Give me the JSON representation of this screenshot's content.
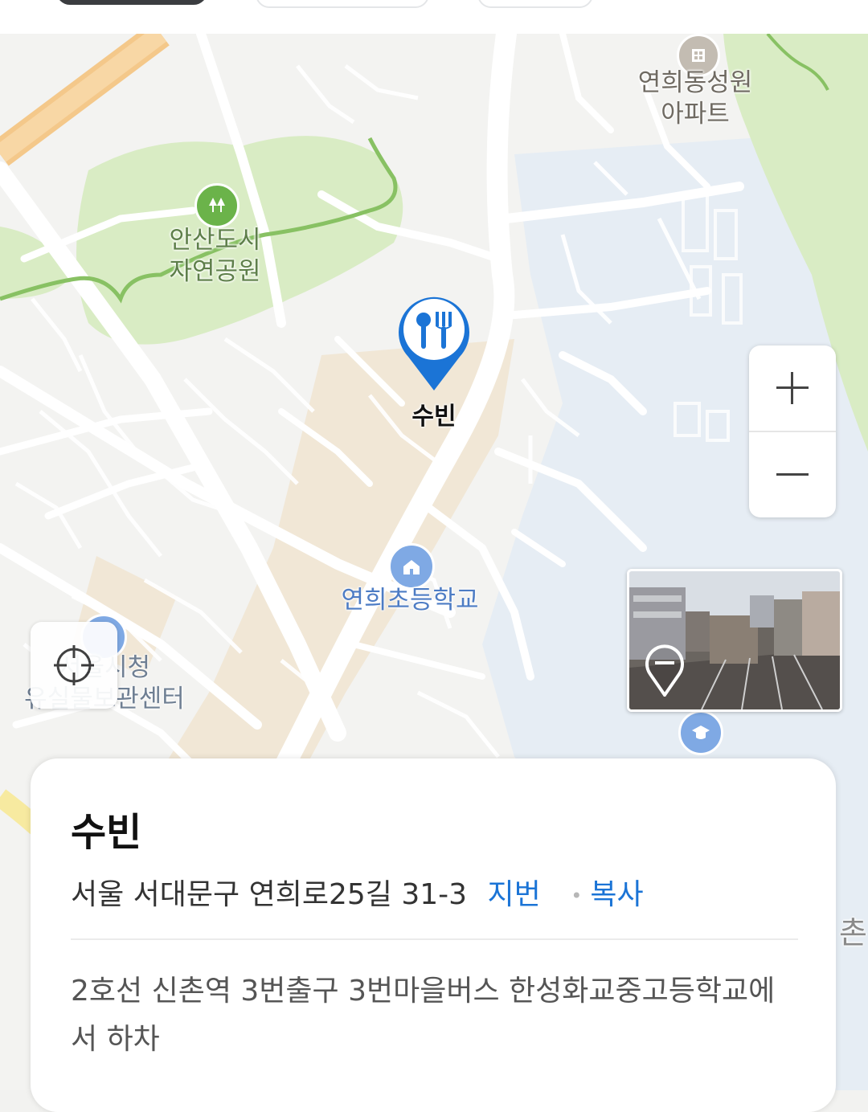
{
  "map": {
    "labels": {
      "apartment": "연희동성원\n아파트",
      "park": "안산도시\n자연공원",
      "school": "연희초등학교",
      "center": "서울시청\n유실물보관센터",
      "edge": "촌"
    },
    "marker": {
      "icon": "restaurant-pin-icon",
      "label": "수빈"
    },
    "zoom_in_label": "+",
    "zoom_out_label": "−",
    "locate_icon": "crosshair-icon",
    "street_view_icon": "street-view-pin-icon"
  },
  "place": {
    "name": "수빈",
    "address": "서울 서대문구 연희로25길 31-3",
    "jibun_label": "지번",
    "copy_label": "복사",
    "directions": "2호선 신촌역 3번출구 3번마을버스 한성화교중고등학교에서 하차"
  },
  "colors": {
    "accent": "#1b74d6",
    "park": "#d9ecc4",
    "water": "#e6edf4",
    "commercial": "#f1e7d6",
    "road": "#ffffff"
  }
}
